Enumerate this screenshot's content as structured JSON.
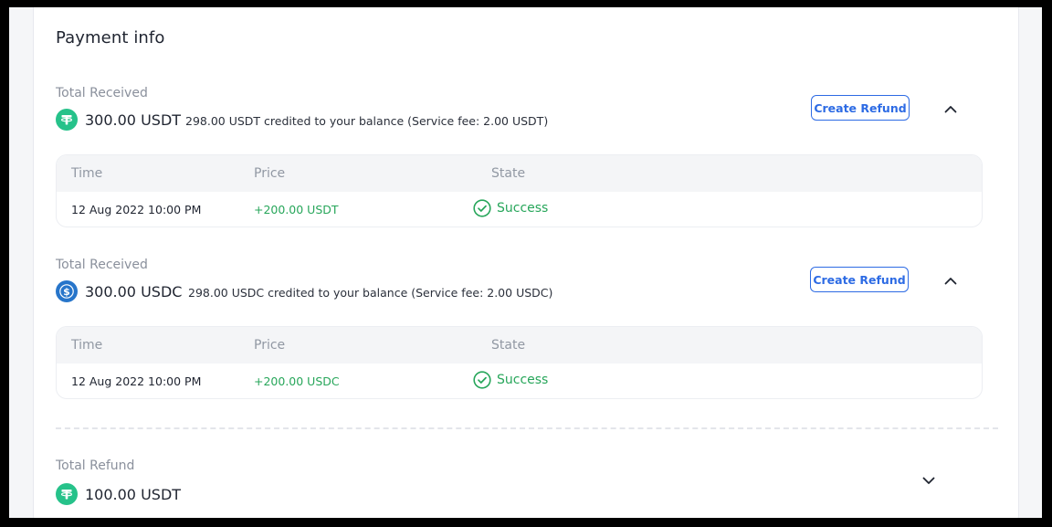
{
  "page": {
    "title": "Payment info"
  },
  "received": [
    {
      "label": "Total Received",
      "coin_icon": "usdt-icon",
      "coin_color": "#26c28a",
      "amount": "300.00 USDT",
      "credit_note": "298.00 USDT credited to your balance (Service fee: 2.00 USDT)",
      "refund_button": "Create Refund",
      "expanded": true,
      "table": {
        "columns": [
          "Time",
          "Price",
          "State"
        ],
        "rows": [
          {
            "time": "12 Aug 2022 10:00 PM",
            "price": "+200.00 USDT",
            "state": "Success"
          }
        ]
      }
    },
    {
      "label": "Total Received",
      "coin_icon": "usdc-icon",
      "coin_color": "#2775ca",
      "amount": "300.00 USDC",
      "credit_note": "298.00 USDC credited to your balance (Service fee: 2.00 USDC)",
      "refund_button": "Create Refund",
      "expanded": true,
      "table": {
        "columns": [
          "Time",
          "Price",
          "State"
        ],
        "rows": [
          {
            "time": "12 Aug 2022 10:00 PM",
            "price": "+200.00 USDC",
            "state": "Success"
          }
        ]
      }
    }
  ],
  "refund": {
    "label": "Total Refund",
    "coin_icon": "usdt-icon",
    "coin_color": "#26c28a",
    "amount": "100.00 USDT",
    "expanded": false
  },
  "colors": {
    "accent": "#2d6be4",
    "success": "#27a65a"
  }
}
